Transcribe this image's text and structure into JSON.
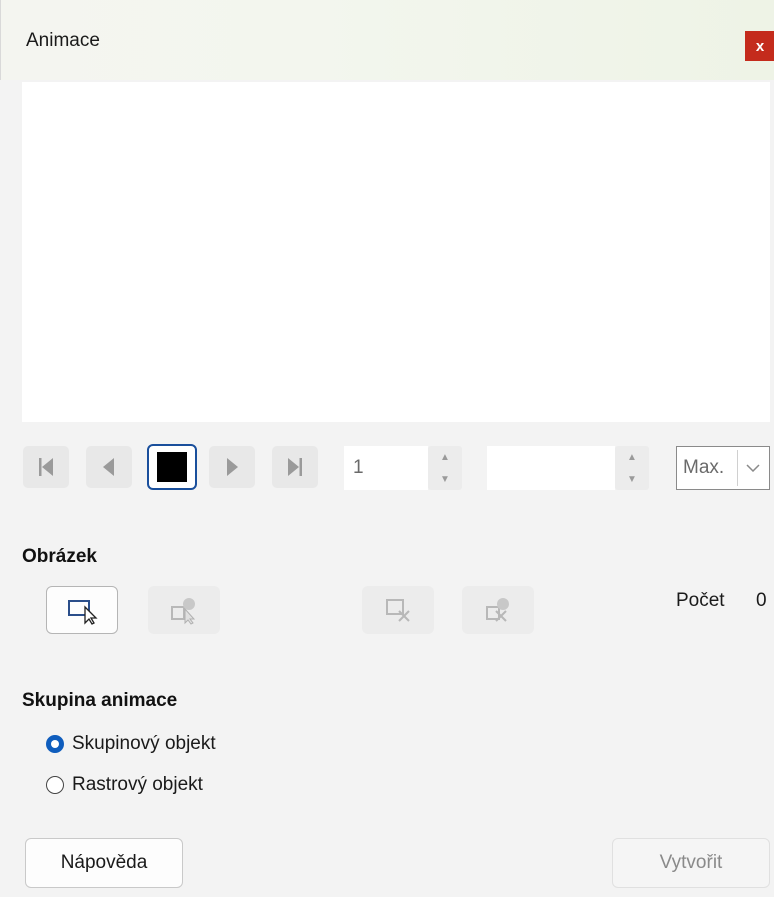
{
  "window": {
    "title": "Animace",
    "close_label": "x"
  },
  "playback": {
    "first_icon": "skip-to-first-icon",
    "prev_icon": "play-backward-icon",
    "stop_icon": "stop-icon",
    "next_icon": "play-forward-icon",
    "last_icon": "skip-to-last-icon",
    "frame_value": "1",
    "duration_value": "",
    "loop_value": "Max."
  },
  "image_section": {
    "heading": "Obrázek",
    "count_label": "Počet",
    "count_value": "0",
    "tools": [
      {
        "icon": "apply-object-icon",
        "enabled": true
      },
      {
        "icon": "apply-objects-individually-icon",
        "enabled": false
      },
      {
        "icon": "delete-current-image-icon",
        "enabled": false
      },
      {
        "icon": "delete-all-images-icon",
        "enabled": false
      }
    ]
  },
  "animation_group": {
    "heading": "Skupina animace",
    "options": [
      {
        "label": "Skupinový objekt",
        "checked": true
      },
      {
        "label": "Rastrový objekt",
        "checked": false
      }
    ]
  },
  "buttons": {
    "help": "Nápověda",
    "create": "Vytvořit"
  },
  "colors": {
    "close_bg": "#c42b1c",
    "radio_accent": "#0f5dbd",
    "focus_border": "#1a4f9c"
  }
}
